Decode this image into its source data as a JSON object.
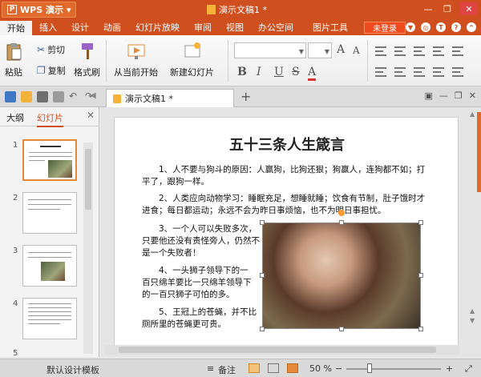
{
  "titlebar": {
    "app_name": "WPS 演示",
    "doc_title": "演示文稿1 *"
  },
  "menubar": {
    "items": [
      "开始",
      "插入",
      "设计",
      "动画",
      "幻灯片放映",
      "审阅",
      "视图",
      "办公空间"
    ],
    "tool_tab": "图片工具",
    "login_label": "未登录"
  },
  "ribbon": {
    "paste": "粘贴",
    "cut": "剪切",
    "copy": "复制",
    "format_painter": "格式刷",
    "from_current": "从当前开始",
    "new_slide": "新建幻灯片",
    "bold": "B",
    "italic": "I",
    "underline": "U",
    "strike": "S",
    "font_grow": "A",
    "font_shrink": "A",
    "font_color": "A"
  },
  "tabs": {
    "doc_tab": "演示文稿1 *"
  },
  "panel": {
    "tab_outline": "大纲",
    "tab_slides": "幻灯片",
    "slide_numbers": [
      "1",
      "2",
      "3",
      "4",
      "5"
    ]
  },
  "slide": {
    "title": "五十三条人生箴言",
    "p1": "1、人不要与狗斗的原因：人赢狗，比狗还狠；狗赢人，连狗都不如；打平了，跟狗一样。",
    "p2": "2、人类应向动物学习：睡眠充足，想睡就睡；饮食有节制，肚子饿时才进食；每日都运动；永远不会为昨日事烦恼，也不为明日事担忧。",
    "p3": "3、一个人可以失败多次，只要他还没有责怪旁人，仍然不是一个失败者！",
    "p4": "4、一头狮子领导下的一百只绵羊要比一只绵羊领导下的一百只狮子可怕的多。",
    "p5": "5、王冠上的苍蝇，并不比厕所里的苍蝇更可贵。"
  },
  "statusbar": {
    "template": "默认设计模板",
    "notes": "备注",
    "zoom": "50 %",
    "zoom_minus": "−",
    "zoom_plus": "+"
  }
}
